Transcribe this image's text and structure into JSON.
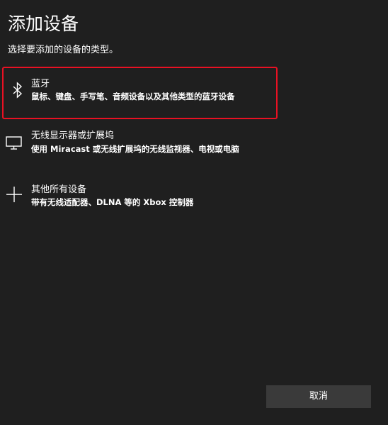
{
  "dialog": {
    "title": "添加设备",
    "subtitle": "选择要添加的设备的类型。"
  },
  "options": [
    {
      "icon": "bluetooth-icon",
      "label": "蓝牙",
      "description": "鼠标、键盘、手写笔、音频设备以及其他类型的蓝牙设备",
      "highlighted": true
    },
    {
      "icon": "monitor-icon",
      "label": "无线显示器或扩展坞",
      "description": "使用 Miracast 或无线扩展坞的无线监视器、电视或电脑",
      "highlighted": false
    },
    {
      "icon": "plus-icon",
      "label": "其他所有设备",
      "description": "带有无线适配器、DLNA 等的 Xbox 控制器",
      "highlighted": false
    }
  ],
  "footer": {
    "cancel_label": "取消"
  },
  "colors": {
    "background": "#1f1f1f",
    "highlight_border": "#e81123",
    "button_background": "#3a3a3a",
    "text": "#ffffff"
  }
}
